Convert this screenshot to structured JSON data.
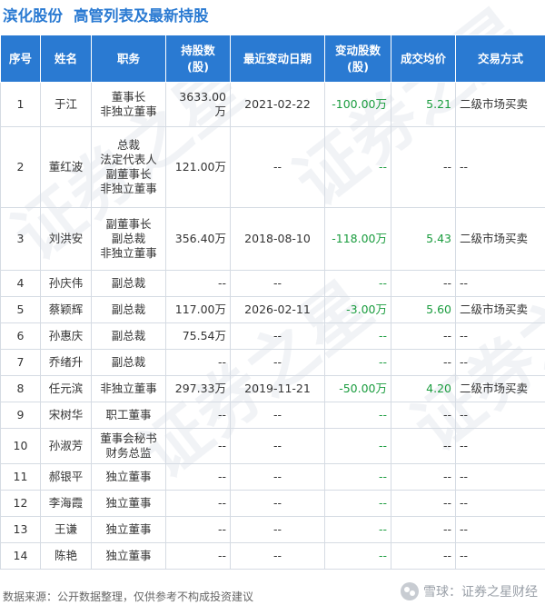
{
  "header": {
    "company": "滨化股份",
    "title": "高管列表及最新持股"
  },
  "watermark": "证券之星",
  "table": {
    "columns": {
      "seq": "序号",
      "name": "姓名",
      "role": "职务",
      "shares": "持股数\n(股)",
      "date": "最近变动日期",
      "change": "变动股数\n(股)",
      "price": "成交均价",
      "mode": "交易方式"
    },
    "rows": [
      {
        "seq": "1",
        "name": "于江",
        "roles": [
          "董事长",
          "非独立董事"
        ],
        "shares": "3633.00万",
        "date": "2021-02-22",
        "change": "-100.00万",
        "price": "5.21",
        "mode": "二级市场买卖"
      },
      {
        "seq": "2",
        "name": "董红波",
        "roles": [
          "总裁",
          "法定代表人",
          "副董事长",
          "非独立董事"
        ],
        "shares": "121.00万",
        "date": "--",
        "change": "--",
        "price": "--",
        "mode": "--"
      },
      {
        "seq": "3",
        "name": "刘洪安",
        "roles": [
          "副董事长",
          "副总裁",
          "非独立董事"
        ],
        "shares": "356.40万",
        "date": "2018-08-10",
        "change": "-118.00万",
        "price": "5.43",
        "mode": "二级市场买卖"
      },
      {
        "seq": "4",
        "name": "孙庆伟",
        "roles": [
          "副总裁"
        ],
        "shares": "--",
        "date": "--",
        "change": "--",
        "price": "--",
        "mode": "--"
      },
      {
        "seq": "5",
        "name": "蔡颖辉",
        "roles": [
          "副总裁"
        ],
        "shares": "117.00万",
        "date": "2026-02-11",
        "change": "-3.00万",
        "price": "5.60",
        "mode": "二级市场买卖"
      },
      {
        "seq": "6",
        "name": "孙惠庆",
        "roles": [
          "副总裁"
        ],
        "shares": "75.54万",
        "date": "--",
        "change": "--",
        "price": "--",
        "mode": "--"
      },
      {
        "seq": "7",
        "name": "乔绪升",
        "roles": [
          "副总裁"
        ],
        "shares": "--",
        "date": "--",
        "change": "--",
        "price": "--",
        "mode": "--"
      },
      {
        "seq": "8",
        "name": "任元滨",
        "roles": [
          "非独立董事"
        ],
        "shares": "297.33万",
        "date": "2019-11-21",
        "change": "-50.00万",
        "price": "4.20",
        "mode": "二级市场买卖"
      },
      {
        "seq": "9",
        "name": "宋树华",
        "roles": [
          "职工董事"
        ],
        "shares": "--",
        "date": "--",
        "change": "--",
        "price": "--",
        "mode": "--"
      },
      {
        "seq": "10",
        "name": "孙淑芳",
        "roles": [
          "董事会秘书",
          "财务总监"
        ],
        "shares": "--",
        "date": "--",
        "change": "--",
        "price": "--",
        "mode": "--"
      },
      {
        "seq": "11",
        "name": "郝银平",
        "roles": [
          "独立董事"
        ],
        "shares": "--",
        "date": "--",
        "change": "--",
        "price": "--",
        "mode": "--"
      },
      {
        "seq": "12",
        "name": "李海霞",
        "roles": [
          "独立董事"
        ],
        "shares": "--",
        "date": "--",
        "change": "--",
        "price": "--",
        "mode": "--"
      },
      {
        "seq": "13",
        "name": "王谦",
        "roles": [
          "独立董事"
        ],
        "shares": "--",
        "date": "--",
        "change": "--",
        "price": "--",
        "mode": "--"
      },
      {
        "seq": "14",
        "name": "陈艳",
        "roles": [
          "独立董事"
        ],
        "shares": "--",
        "date": "--",
        "change": "--",
        "price": "--",
        "mode": "--"
      }
    ]
  },
  "footer": {
    "source": "数据来源：公开数据整理，仅供参考不构成投资建议"
  },
  "brand": {
    "logo_icon": "snowball-logo-icon",
    "text": "雪球：证券之星财经"
  },
  "colors": {
    "accent": "#2a7ad2",
    "negative": "#1a9c3e"
  }
}
